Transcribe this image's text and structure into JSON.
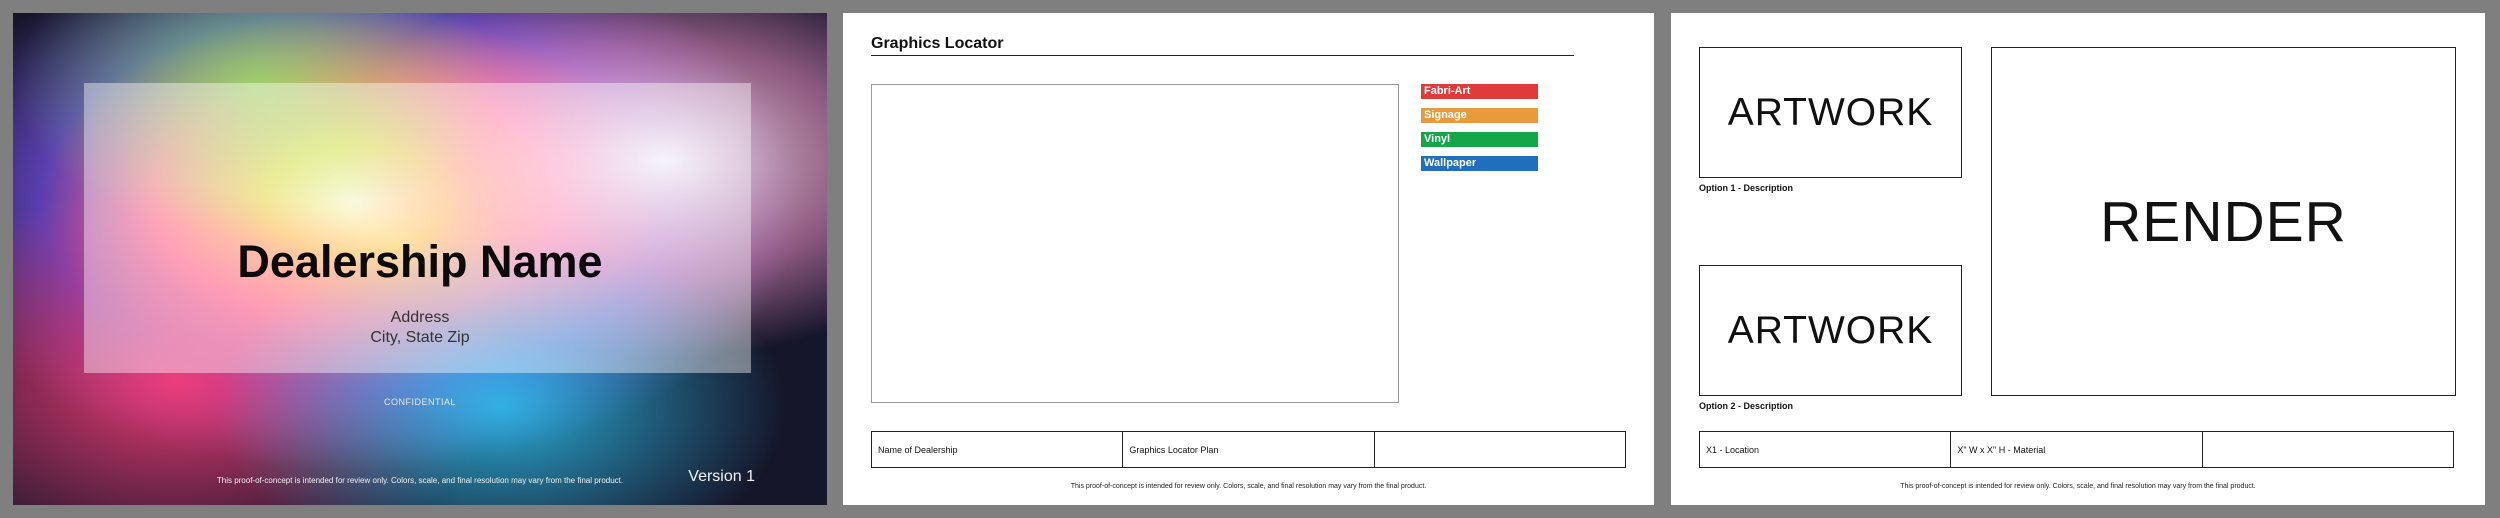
{
  "cover": {
    "dealership_name": "Dealership Name",
    "address": "Address",
    "city_state_zip": "City, State Zip",
    "confidential": "CONFIDENTIAL",
    "disclaimer": "This proof-of-concept is intended for review only. Colors, scale, and final resolution may vary from the final product.",
    "version": "Version 1"
  },
  "locator": {
    "title": "Graphics Locator",
    "legend": [
      {
        "label": "Fabri-Art",
        "color": "#e03a3a"
      },
      {
        "label": "Signage",
        "color": "#e99a3d"
      },
      {
        "label": "Vinyl",
        "color": "#15a64a"
      },
      {
        "label": "Wallpaper",
        "color": "#1f6fbd"
      }
    ],
    "footer": [
      "Name of Dealership",
      "Graphics Locator Plan",
      ""
    ],
    "disclaimer": "This proof-of-concept is intended for review only. Colors, scale, and final resolution may vary from the final product."
  },
  "options": {
    "artwork_1": "ARTWORK",
    "option_1_desc": "Option 1 - Description",
    "artwork_2": "ARTWORK",
    "option_2_desc": "Option 2 - Description",
    "render": "RENDER",
    "footer": [
      "X1 - Location",
      "X\" W x X\" H - Material",
      ""
    ],
    "disclaimer": "This proof-of-concept is intended for review only. Colors, scale, and final resolution may vary from the final product."
  }
}
